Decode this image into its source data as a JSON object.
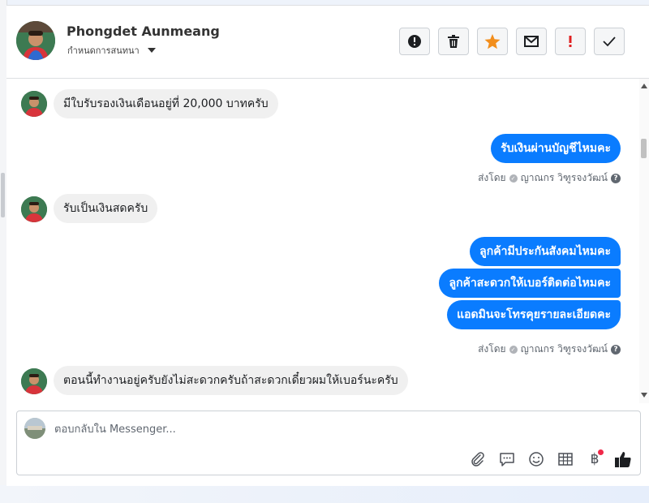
{
  "header": {
    "contact_name": "Phongdet Aunmeang",
    "conversation_settings_label": "กำหนดการสนทนา",
    "toolbar": [
      {
        "name": "report-button",
        "icon": "exclamation-circle-icon"
      },
      {
        "name": "delete-button",
        "icon": "trash-icon"
      },
      {
        "name": "star-button",
        "icon": "star-icon",
        "color": "#f28e1c"
      },
      {
        "name": "mark-unread-button",
        "icon": "envelope-icon"
      },
      {
        "name": "spam-button",
        "icon": "exclamation-icon",
        "color": "#e02020"
      },
      {
        "name": "done-button",
        "icon": "checkmark-icon"
      }
    ]
  },
  "messages": [
    {
      "direction": "incoming",
      "text": "มีใบรับรองเงินเดือนอยู่ที่ 20,000 บาทครับ"
    },
    {
      "direction": "outgoing",
      "text": "รับเงินผ่านบัญชีไหมคะ"
    },
    {
      "direction": "incoming",
      "text": "รับเป็นเงินสดครับ"
    },
    {
      "direction": "outgoing",
      "text": "ลูกค้ามีประกันสังคมไหมคะ"
    },
    {
      "direction": "outgoing",
      "text": "ลูกค้าสะดวกให้เบอร์ติดต่อไหมคะ"
    },
    {
      "direction": "outgoing",
      "text": "แอดมินจะโทรคุยรายละเอียดคะ"
    },
    {
      "direction": "incoming",
      "text": "ตอนนี้ทำงานอยู่ครับยังไม่สะดวกครับถ้าสะดวกเดี๋ยวผมให้เบอร์นะครับ"
    }
  ],
  "sent_by": {
    "prefix": "ส่งโดย",
    "agent": "ญาณกร วิฑูรจงวัฒน์",
    "help_glyph": "?"
  },
  "composer": {
    "placeholder": "ตอบกลับใน Messenger...",
    "value": "",
    "icons": [
      "paperclip-icon",
      "saved-reply-icon",
      "emoji-icon",
      "table-icon",
      "baht-icon",
      "thumbs-up-icon"
    ],
    "baht_glyph": "฿"
  }
}
